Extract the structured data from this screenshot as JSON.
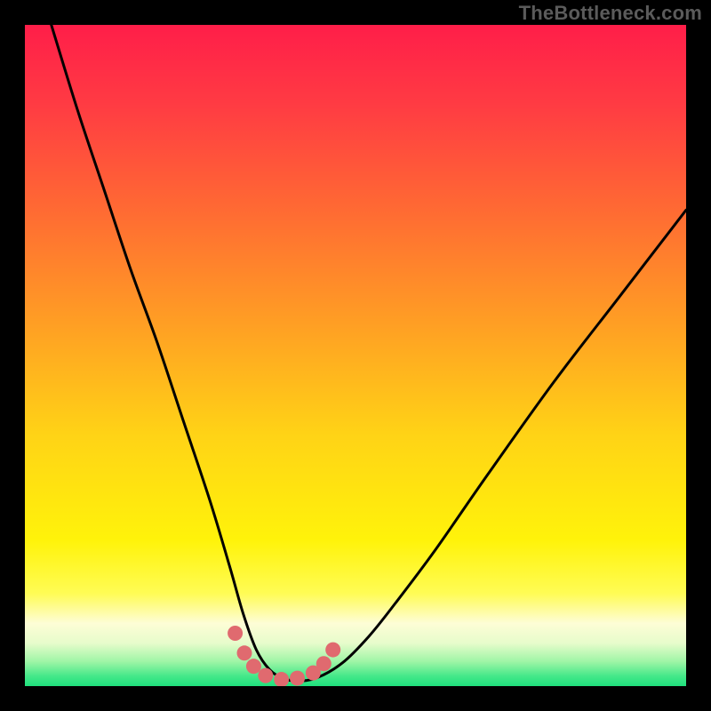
{
  "attribution": "TheBottleneck.com",
  "gradient": {
    "stops": [
      {
        "offset": 0.0,
        "color": "#ff1e49"
      },
      {
        "offset": 0.12,
        "color": "#ff3b43"
      },
      {
        "offset": 0.28,
        "color": "#ff6a33"
      },
      {
        "offset": 0.45,
        "color": "#ff9e24"
      },
      {
        "offset": 0.62,
        "color": "#ffd316"
      },
      {
        "offset": 0.78,
        "color": "#fff30a"
      },
      {
        "offset": 0.86,
        "color": "#fffc55"
      },
      {
        "offset": 0.905,
        "color": "#fdfdd6"
      },
      {
        "offset": 0.935,
        "color": "#e7fccb"
      },
      {
        "offset": 0.963,
        "color": "#9ef5a6"
      },
      {
        "offset": 0.985,
        "color": "#44e889"
      },
      {
        "offset": 1.0,
        "color": "#1fe07d"
      }
    ]
  },
  "chart_data": {
    "type": "line",
    "title": "",
    "xlabel": "",
    "ylabel": "",
    "xlim": [
      0,
      1
    ],
    "ylim": [
      0,
      1
    ],
    "legend": false,
    "background_gradient": "vertical red→yellow→green (bottleneck severity)",
    "series": [
      {
        "name": "bottleneck-curve",
        "stroke": "#000000",
        "x": [
          0.04,
          0.08,
          0.12,
          0.16,
          0.2,
          0.24,
          0.28,
          0.31,
          0.33,
          0.35,
          0.37,
          0.39,
          0.41,
          0.44,
          0.48,
          0.52,
          0.56,
          0.62,
          0.7,
          0.8,
          0.9,
          1.0
        ],
        "y": [
          1.0,
          0.87,
          0.75,
          0.63,
          0.52,
          0.4,
          0.28,
          0.18,
          0.11,
          0.055,
          0.025,
          0.012,
          0.008,
          0.012,
          0.035,
          0.075,
          0.125,
          0.205,
          0.32,
          0.46,
          0.59,
          0.72
        ]
      },
      {
        "name": "highlight-dots",
        "stroke": "#e06a6f",
        "type": "scatter",
        "x": [
          0.318,
          0.332,
          0.346,
          0.364,
          0.388,
          0.412,
          0.436,
          0.452,
          0.466
        ],
        "y": [
          0.08,
          0.05,
          0.03,
          0.016,
          0.01,
          0.012,
          0.02,
          0.034,
          0.055
        ]
      }
    ]
  }
}
